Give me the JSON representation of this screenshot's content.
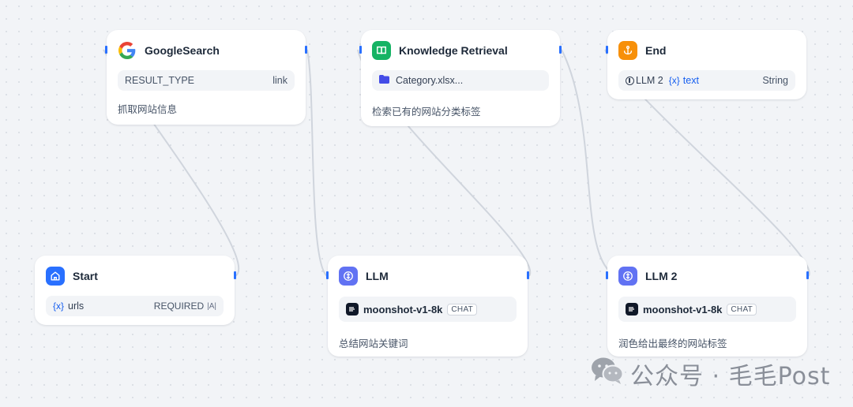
{
  "nodes": {
    "google_search": {
      "title": "GoogleSearch",
      "field_key": "RESULT_TYPE",
      "field_value": "link",
      "description": "抓取网站信息"
    },
    "knowledge_retrieval": {
      "title": "Knowledge Retrieval",
      "dataset": "Category.xlsx...",
      "description": "检索已有的网站分类标签"
    },
    "end": {
      "title": "End",
      "var_source": "LLM 2",
      "var_symbol": "{x}",
      "var_name": "text",
      "var_type": "String"
    },
    "start": {
      "title": "Start",
      "var_symbol": "{x}",
      "var_name": "urls",
      "required": "REQUIRED",
      "input_type_icon": "|A|"
    },
    "llm": {
      "title": "LLM",
      "model": "moonshot-v1-8k",
      "mode": "CHAT",
      "description": "总结网站关键词"
    },
    "llm2": {
      "title": "LLM 2",
      "model": "moonshot-v1-8k",
      "mode": "CHAT",
      "description": "润色给出最终的网站标签"
    }
  },
  "watermark": {
    "text": "公众号 · 毛毛Post"
  },
  "colors": {
    "handle": "#2970ff",
    "edge": "#d0d5dd",
    "start_icon_bg": "#2970ff",
    "llm_icon_bg": "#6172f3",
    "knowledge_icon_bg": "#16b364",
    "end_icon_bg": "#f79009"
  },
  "icons": {
    "google_search": "google-logo-icon",
    "knowledge_retrieval": "book-icon",
    "end": "anchor-icon",
    "start": "home-icon",
    "llm": "brain-icon",
    "model": "moonshot-logo-icon",
    "dataset": "folder-icon",
    "watermark": "wechat-icon"
  }
}
